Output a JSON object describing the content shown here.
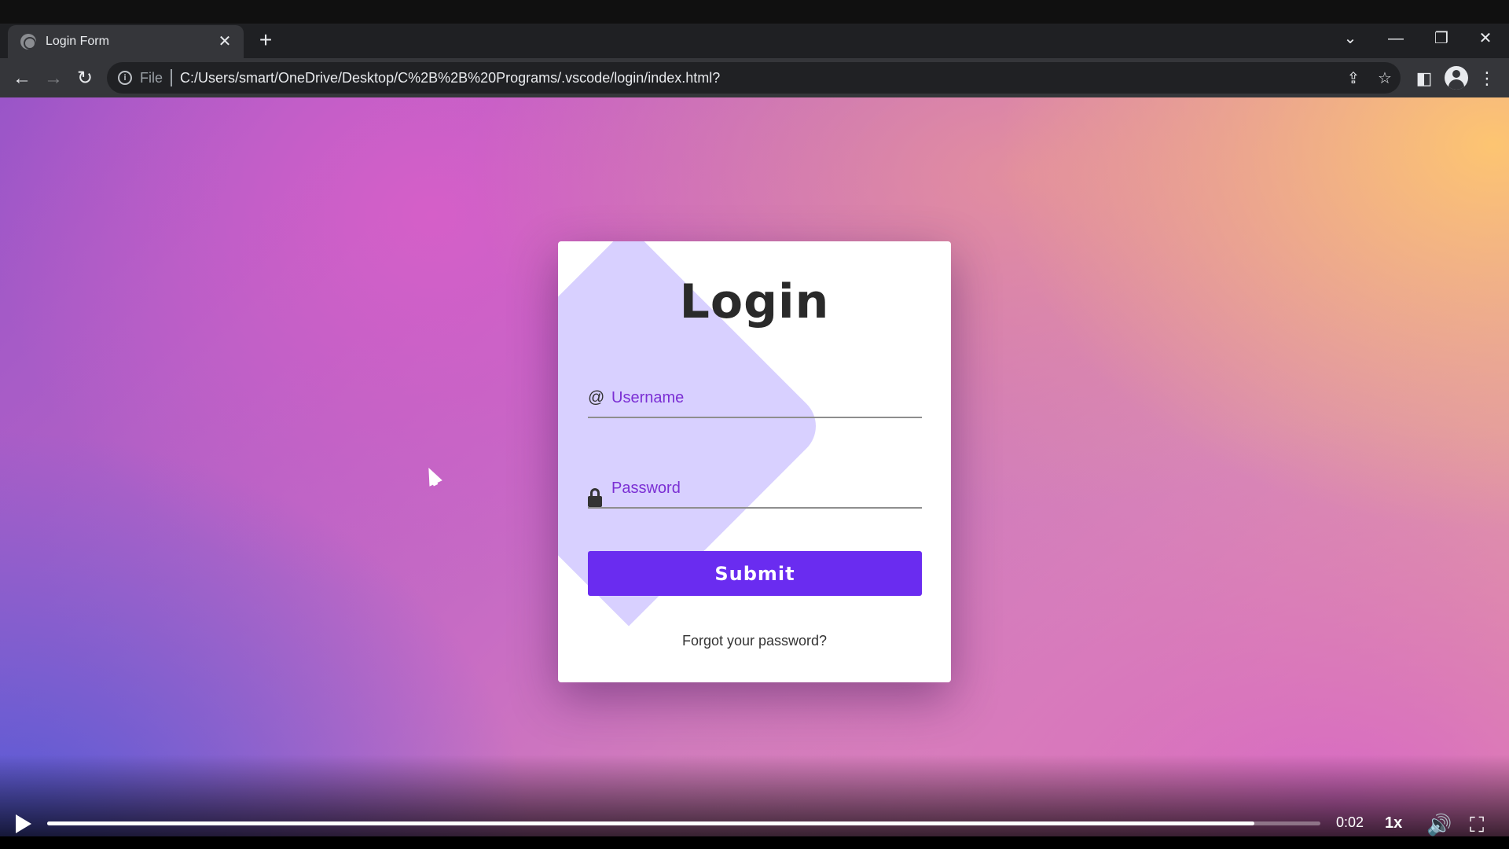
{
  "browser": {
    "tab_title": "Login Form",
    "tab_close": "✕",
    "new_tab": "+",
    "window_controls": {
      "dropdown": "⌄",
      "minimize": "—",
      "restore": "❐",
      "close": "✕"
    },
    "nav": {
      "back": "←",
      "forward": "→",
      "reload": "↻"
    },
    "address": {
      "scheme_label": "File",
      "url": "C:/Users/smart/OneDrive/Desktop/C%2B%2B%20Programs/.vscode/login/index.html?"
    },
    "toolbar_icons": {
      "share": "⇪",
      "bookmark": "☆",
      "sidepanel": "◧",
      "menu": "⋮"
    }
  },
  "page": {
    "login": {
      "title": "Login",
      "username_icon": "@",
      "username_placeholder": "Username",
      "password_placeholder": "Password",
      "submit_label": "Submit",
      "forgot_link": "Forgot your password?"
    }
  },
  "player": {
    "time": "0:02",
    "speed": "1x",
    "progress_fraction": 0.948,
    "volume_icon": "🔊",
    "fullscreen_icon": "⛶"
  }
}
